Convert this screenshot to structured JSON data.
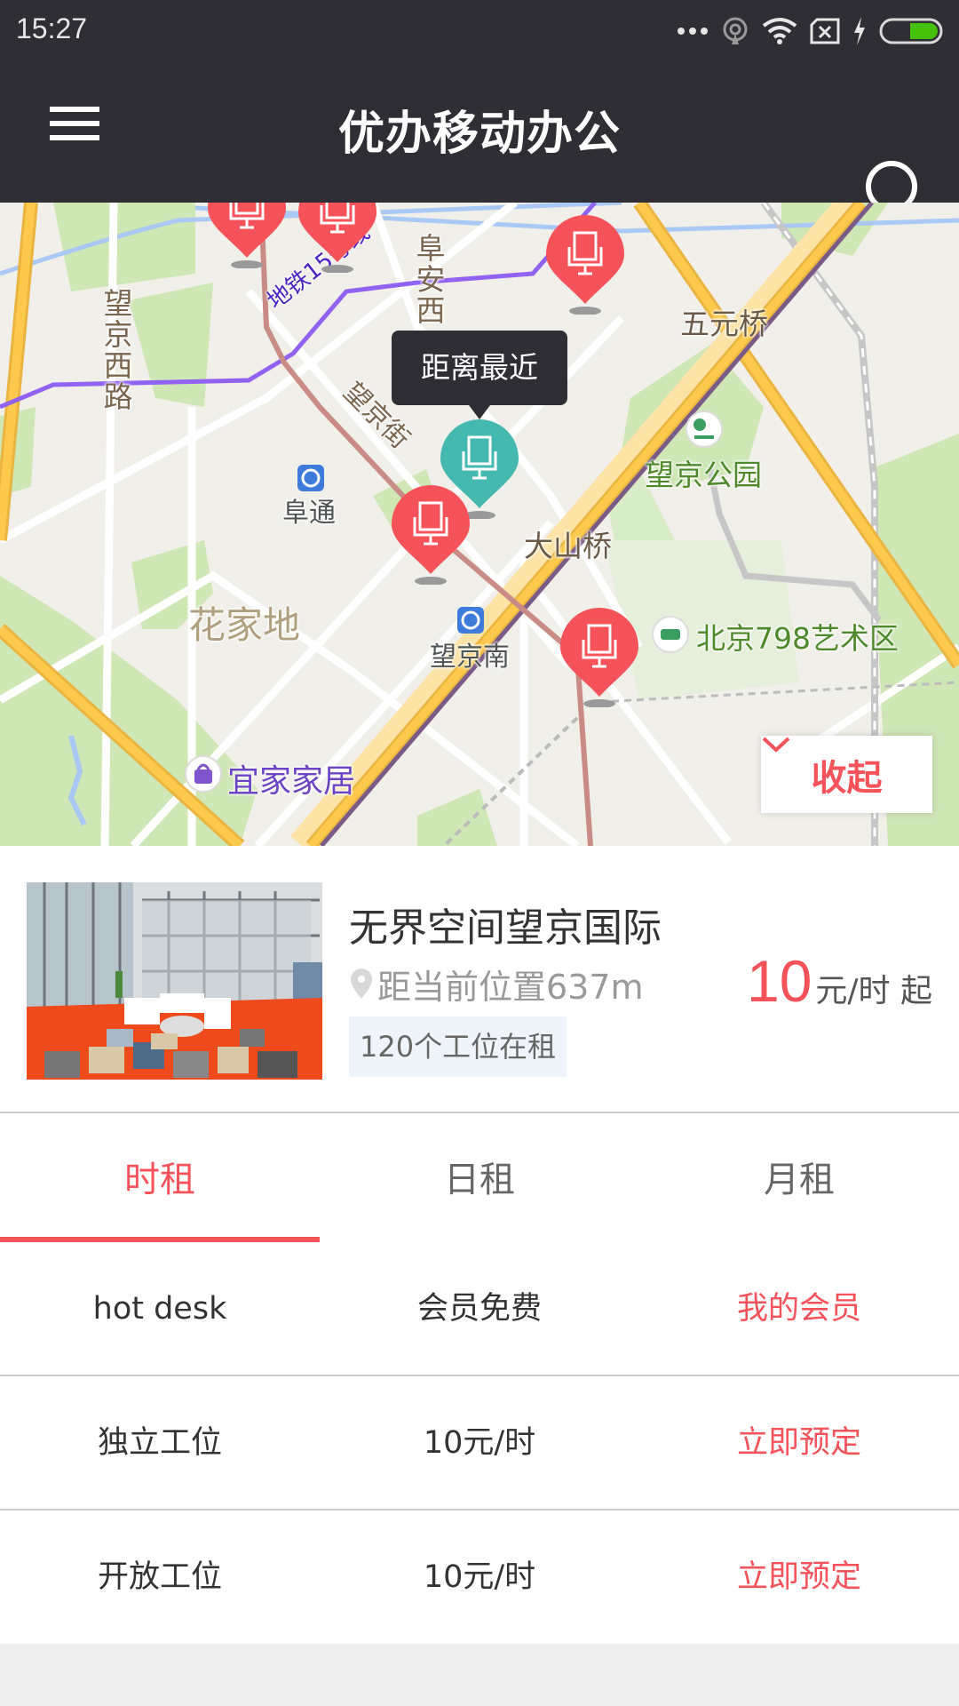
{
  "status_bar": {
    "time": "15:27",
    "icons": [
      "more-dots-icon",
      "hotspot-icon",
      "wifi-icon",
      "no-sim-icon",
      "charging-icon",
      "battery-icon"
    ]
  },
  "header": {
    "title": "优办移动办公",
    "menu_icon": "hamburger-menu-icon",
    "search_icon": "search-icon"
  },
  "map": {
    "labels": {
      "wangjing_xilu": "望京西路",
      "fuan_xi": "阜安西",
      "line15": "地铁15号线",
      "wangjing_jie": "望京街",
      "wuyuan_qiao": "五元桥",
      "wangjing_park": "望京公园",
      "futong": "阜通",
      "dashan_qiao": "大山桥",
      "huajiadi": "花家地",
      "wangjing_nan": "望京南",
      "art798": "北京798艺术区",
      "ikea": "宜家家居"
    },
    "tooltip": "距离最近",
    "collapse_label": "收起",
    "colors": {
      "pin_default": "#f5525a",
      "pin_nearest": "#45b9b0"
    }
  },
  "listing": {
    "name": "无界空间望京国际",
    "distance": "距当前位置637m",
    "seats_badge": "120个工位在租",
    "price_value": "10",
    "price_unit": "元/时 起"
  },
  "tabs": [
    {
      "label": "时租",
      "active": true
    },
    {
      "label": "日租",
      "active": false
    },
    {
      "label": "月租",
      "active": false
    }
  ],
  "rows": [
    {
      "type": "hot desk",
      "price": "会员免费",
      "action": "我的会员"
    },
    {
      "type": "独立工位",
      "price": "10元/时",
      "action": "立即预定"
    },
    {
      "type": "开放工位",
      "price": "10元/时",
      "action": "立即预定"
    }
  ],
  "accent_color": "#f5525a"
}
